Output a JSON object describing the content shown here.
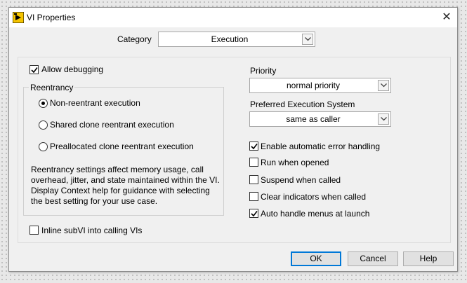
{
  "window": {
    "title": "VI Properties"
  },
  "category": {
    "label": "Category",
    "value": "Execution"
  },
  "allow_debugging": {
    "label": "Allow debugging",
    "checked": true
  },
  "reentrancy": {
    "title": "Reentrancy",
    "options": [
      {
        "label": "Non-reentrant execution",
        "selected": true
      },
      {
        "label": "Shared clone reentrant execution",
        "selected": false
      },
      {
        "label": "Preallocated clone reentrant execution",
        "selected": false
      }
    ],
    "description": "Reentrancy settings affect memory usage, call overhead, jitter, and state maintained within the VI. Display Context help for guidance with selecting the best setting for your use case."
  },
  "inline_subvi": {
    "label": "Inline subVI into calling VIs",
    "checked": false
  },
  "priority": {
    "label": "Priority",
    "value": "normal priority"
  },
  "execution_system": {
    "label": "Preferred Execution System",
    "value": "same as caller"
  },
  "options": [
    {
      "label": "Enable automatic error handling",
      "checked": true
    },
    {
      "label": "Run when opened",
      "checked": false
    },
    {
      "label": "Suspend when called",
      "checked": false
    },
    {
      "label": "Clear indicators when called",
      "checked": false
    },
    {
      "label": "Auto handle menus at launch",
      "checked": true
    }
  ],
  "buttons": {
    "ok": "OK",
    "cancel": "Cancel",
    "help": "Help"
  }
}
